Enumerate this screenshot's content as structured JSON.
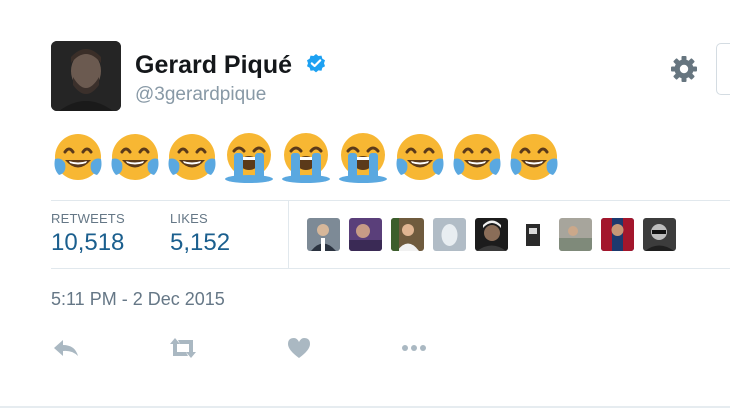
{
  "user": {
    "name": "Gerard Piqué",
    "handle": "@3gerardpique",
    "verified": true
  },
  "tweet": {
    "emojis": [
      "face-with-tears-of-joy",
      "face-with-tears-of-joy",
      "face-with-tears-of-joy",
      "loudly-crying-face",
      "loudly-crying-face",
      "loudly-crying-face",
      "face-with-tears-of-joy",
      "face-with-tears-of-joy",
      "face-with-tears-of-joy"
    ],
    "timestamp": "5:11 PM - 2 Dec 2015"
  },
  "stats": {
    "retweets_label": "RETWEETS",
    "retweets_value": "10,518",
    "likes_label": "LIKES",
    "likes_value": "5,152"
  },
  "likers_count_shown": 9,
  "actions": [
    "reply-icon",
    "retweet-icon",
    "like-icon",
    "more-icon"
  ],
  "colors": {
    "accent_blue": "#1b5f8e",
    "verified_blue": "#1da1f2",
    "muted": "#8899a6",
    "icon_gray": "#aab8c2",
    "divider": "#e1e8ed"
  }
}
